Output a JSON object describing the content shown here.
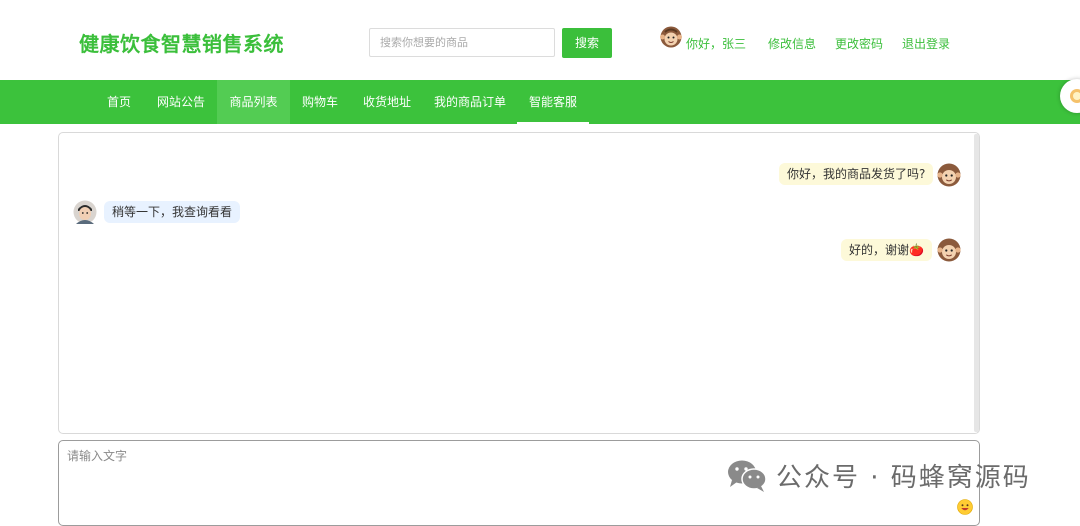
{
  "header": {
    "logo": "健康饮食智慧销售系统",
    "search_placeholder": "搜索你想要的商品",
    "search_button": "搜索",
    "greeting": "你好，张三",
    "links": [
      "修改信息",
      "更改密码",
      "退出登录"
    ]
  },
  "nav": {
    "items": [
      "首页",
      "网站公告",
      "商品列表",
      "购物车",
      "收货地址",
      "我的商品订单",
      "智能客服"
    ],
    "hovered": "商品列表",
    "active": "智能客服"
  },
  "chat": {
    "messages": [
      {
        "from": "user",
        "text": "你好，我的商品发货了吗?"
      },
      {
        "from": "service",
        "text": "稍等一下，我查询看看"
      },
      {
        "from": "user",
        "text": "好的，谢谢🍅"
      }
    ],
    "input_placeholder": "请输入文字"
  },
  "watermark": {
    "text": "公众号 · 码蜂窝源码"
  },
  "colors": {
    "brand": "#3bbf3b",
    "nav_bg": "#3cc23c",
    "user_bubble": "#fdf9d9",
    "service_bubble": "#e8f2ff"
  },
  "icons": {
    "user_avatar": "monkey-avatar-icon",
    "service_avatar": "person-avatar-icon",
    "emoji": "smiley-emoji-icon",
    "watermark": "wechat-icon"
  }
}
